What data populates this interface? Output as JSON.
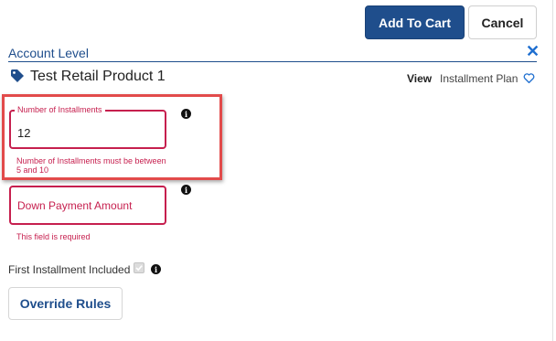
{
  "header": {
    "add_to_cart_label": "Add To Cart",
    "cancel_label": "Cancel"
  },
  "section": {
    "title": "Account Level",
    "close_glyph": "✕"
  },
  "product": {
    "name": "Test Retail Product 1",
    "view_label": "View",
    "plan_label": "Installment Plan"
  },
  "form": {
    "installments": {
      "label": "Number of Installments",
      "value": "12",
      "error": "Number of Installments must be between 5 and 10"
    },
    "down_payment": {
      "placeholder": "Down Payment Amount",
      "error": "This field is required"
    },
    "first_installment": {
      "label": "First Installment Included",
      "checked": true
    },
    "override_label": "Override Rules"
  },
  "icons": {
    "info_glyph": "i",
    "tag_icon": "tag-icon",
    "heart_icon": "heart-outline-icon"
  },
  "colors": {
    "primary": "#1f4e8c",
    "error": "#c61f4e",
    "highlight": "#e24b4b"
  }
}
